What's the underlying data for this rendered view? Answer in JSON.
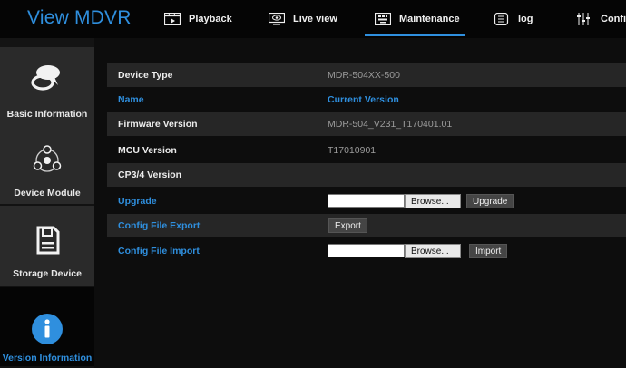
{
  "app": {
    "brand": "View MDVR"
  },
  "nav": [
    {
      "label": "Playback",
      "icon": "playback-icon"
    },
    {
      "label": "Live view",
      "icon": "live-view-icon"
    },
    {
      "label": "Maintenance",
      "icon": "maintenance-icon"
    },
    {
      "label": "log",
      "icon": "log-icon"
    },
    {
      "label": "Config",
      "icon": "config-icon"
    }
  ],
  "sidebar": [
    {
      "label": "Basic Information",
      "icon": "chat-bubble-icon"
    },
    {
      "label": "Device Module",
      "icon": "module-network-icon"
    },
    {
      "label": "Storage Device",
      "icon": "storage-device-icon"
    },
    {
      "label": "Version Information",
      "icon": "info-icon"
    }
  ],
  "info": {
    "device_type": {
      "label": "Device Type",
      "value": "MDR-504XX-500"
    },
    "name": {
      "label": "Name",
      "value": "Current Version"
    },
    "firmware": {
      "label": "Firmware Version",
      "value": "MDR-504_V231_T170401.01"
    },
    "mcu": {
      "label": "MCU Version",
      "value": "T17010901"
    },
    "cp34": {
      "label": "CP3/4 Version",
      "value": ""
    }
  },
  "actions": {
    "upgrade": {
      "label": "Upgrade",
      "browse": "Browse...",
      "button": "Upgrade",
      "path": ""
    },
    "config_export": {
      "label": "Config File Export",
      "button": "Export"
    },
    "config_import": {
      "label": "Config File Import",
      "browse": "Browse...",
      "button": "Import",
      "path": ""
    }
  },
  "colors": {
    "accent": "#2f8fde",
    "row_shade": "#262626",
    "background": "#0d0d0d"
  }
}
